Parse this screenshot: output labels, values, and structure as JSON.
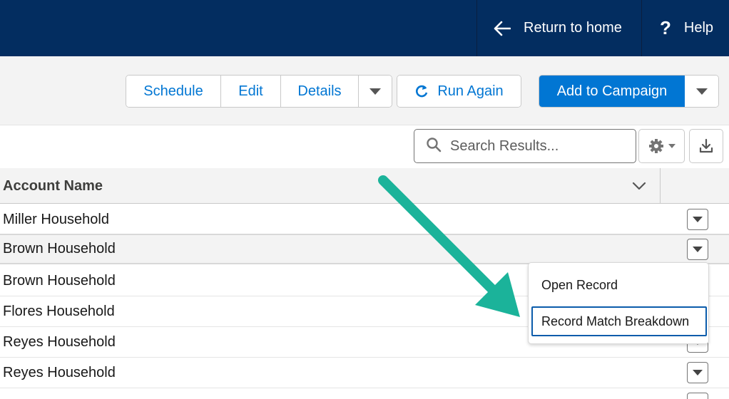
{
  "header": {
    "return_label": "Return to home",
    "help_label": "Help",
    "return_icon": "arrow-left-icon",
    "help_icon": "question-icon",
    "background": "#032d60"
  },
  "toolbar": {
    "schedule_label": "Schedule",
    "edit_label": "Edit",
    "details_label": "Details",
    "run_again_label": "Run Again",
    "add_to_campaign_label": "Add to Campaign",
    "brand_color": "#0176d3"
  },
  "search": {
    "placeholder": "Search Results..."
  },
  "table": {
    "column_header": "Account Name",
    "rows": [
      "Miller Household",
      "Brown Household",
      "Brown Household",
      "Flores Household",
      "Reyes Household",
      "Reyes Household"
    ]
  },
  "row_menu": {
    "items": [
      "Open Record",
      "Record Match Breakdown"
    ]
  },
  "annotation": {
    "arrow_color": "#1bb39a"
  }
}
